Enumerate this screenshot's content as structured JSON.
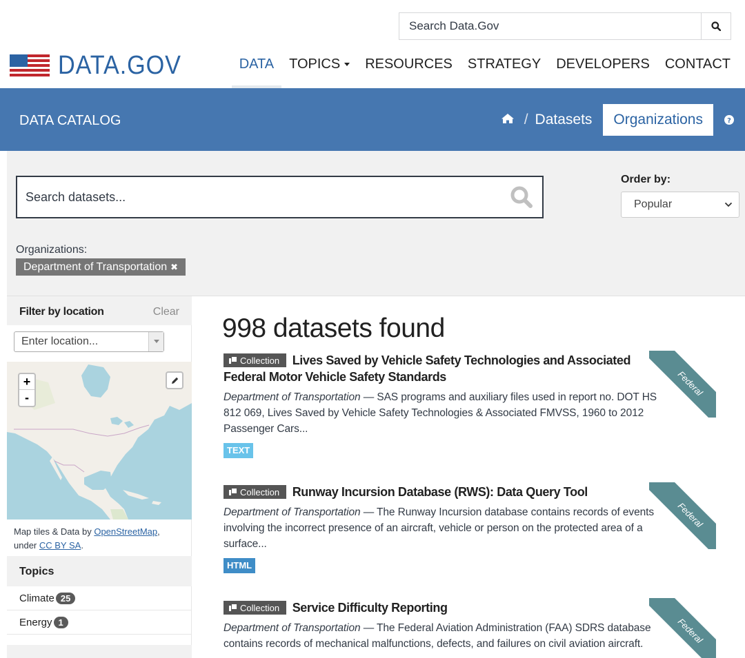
{
  "header": {
    "search_placeholder": "Search Data.Gov",
    "logo_text": "DATA.GOV",
    "nav": [
      {
        "label": "DATA",
        "active": true
      },
      {
        "label": "TOPICS",
        "dropdown": true
      },
      {
        "label": "RESOURCES"
      },
      {
        "label": "STRATEGY"
      },
      {
        "label": "DEVELOPERS"
      },
      {
        "label": "CONTACT"
      }
    ]
  },
  "band": {
    "title": "DATA CATALOG",
    "crumb_sep": "/",
    "datasets": "Datasets",
    "organizations": "Organizations"
  },
  "search": {
    "placeholder": "Search datasets...",
    "order_label": "Order by:",
    "order_value": "Popular",
    "orgs_label": "Organizations:",
    "org_filter": "Department of Transportation"
  },
  "sidebar": {
    "filter_title": "Filter by location",
    "clear": "Clear",
    "location_placeholder": "Enter location...",
    "attrib_prefix": "Map tiles & Data by ",
    "attrib_link1": "OpenStreetMap",
    "attrib_mid": ",",
    "attrib_under": "under ",
    "attrib_link2": "CC BY SA",
    "attrib_end": ".",
    "topics_title": "Topics",
    "topics": [
      {
        "label": "Climate",
        "count": "25"
      },
      {
        "label": "Energy",
        "count": "1"
      }
    ]
  },
  "results": {
    "found": "998 datasets found",
    "collection_label": "Collection",
    "ribbon_label": "Federal",
    "items": [
      {
        "title": "Lives Saved by Vehicle Safety Technologies and Associated Federal Motor Vehicle Safety Standards",
        "org": "Department of Transportation",
        "desc": " — SAS programs and auxiliary files used in report no. DOT HS 812 069, Lives Saved by Vehicle Safety Technologies & Associated FMVSS, 1960 to 2012 Passenger Cars...",
        "format": "TEXT"
      },
      {
        "title": "Runway Incursion Database (RWS): Data Query Tool",
        "org": "Department of Transportation",
        "desc": " — The Runway Incursion database contains records of events involving the incorrect presence of an aircraft, vehicle or person on the protected area of a surface...",
        "format": "HTML"
      },
      {
        "title": "Service Difficulty Reporting",
        "org": "Department of Transportation",
        "desc": " — The Federal Aviation Administration (FAA) SDRS database contains records of mechanical malfunctions, defects, and failures on civil aviation aircraft.",
        "format": ""
      }
    ]
  },
  "colors": {
    "brand_blue": "#2b63a3",
    "band_blue": "#4677b0",
    "ribbon": "#5a8c92"
  }
}
